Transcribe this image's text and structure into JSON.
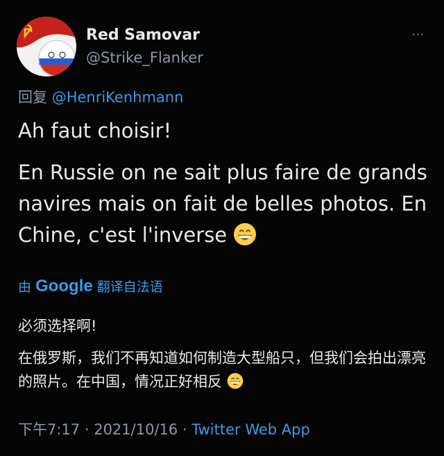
{
  "tweet": {
    "display_name": "Red Samovar",
    "handle": "@Strike_Flanker",
    "more": "···",
    "reply_prefix": "回复",
    "reply_to": "@HenriKenhmann",
    "paragraph1": "Ah faut choisir!",
    "paragraph2": "En Russie on ne sait plus faire de grands navires mais on fait de belles photos. En Chine, c'est l'inverse",
    "translate_prefix": "由",
    "translate_brand": "Google",
    "translate_suffix": "翻译自法语",
    "translation_line1": "必须选择啊!",
    "translation_line2": "在俄罗斯，我们不再知道如何制造大型船只，但我们会拍出漂亮的照片。在中国，情况正好相反",
    "time": "下午7:17",
    "separator": " · ",
    "date": "2021/10/16",
    "source": "Twitter Web App"
  },
  "colors": {
    "background": "#050506",
    "text": "#e7e9ea",
    "secondary": "#8b98a5",
    "link": "#3b9be6"
  },
  "icons": {
    "avatar": "countryball-avatar",
    "emoji": "grinning-face-icon",
    "more": "more-options-icon"
  }
}
